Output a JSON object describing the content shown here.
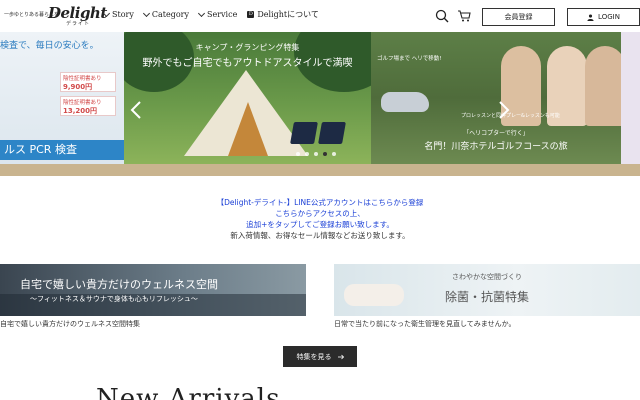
{
  "header": {
    "logo_tagline": "一歩ゆとりある暮らしを",
    "logo_name": "Delight",
    "logo_sub": "デライト",
    "nav": [
      {
        "label": "Story"
      },
      {
        "label": "Category"
      },
      {
        "label": "Service"
      },
      {
        "label": "Delightについて"
      }
    ],
    "register_label": "会員登録",
    "login_label": "LOGIN"
  },
  "hero": {
    "left_slide": {
      "top_text": "検査で、毎日の安心を。",
      "prices": [
        {
          "label": "陰性証明書あり",
          "value": "9,900円",
          "note": "(税込)"
        },
        {
          "label": "陰性証明書あり",
          "value": "13,200円",
          "note": "(税込)"
        }
      ],
      "bar_text": "ルス PCR 検査"
    },
    "main_slide": {
      "caption_small": "キャンプ・グランピング特集",
      "caption_large": "野外でもご自宅でもアウトドアスタイルで満喫"
    },
    "right_slide": {
      "cap_a": "ゴルフ場まで ヘリで移動!",
      "cap_b": "プロレッスンと同伴プレー&レッスンも可能",
      "cap_c": "「ヘリコプターで行く」",
      "cap_d": "名門！川奈ホテルゴルフコースの旅"
    },
    "dots_count": 5,
    "active_dot": 4
  },
  "notice": {
    "line1": "【Delight-デライト-】LINE公式アカウントはこちらから登録",
    "line2": "こちらからアクセスの上、",
    "line3": "追加+をタップしてご登録お願い致します。",
    "line4": "新入荷情報、お得なセール情報などお送り致します。"
  },
  "banners": {
    "left": {
      "title": "自宅で嬉しい貴方だけのウェルネス空間",
      "subtitle": "～フィットネス＆サウナで身体も心もリフレッシュ～",
      "caption": "自宅で嬉しい貴方だけのウェルネス空間特集"
    },
    "right": {
      "title_small": "さわやかな空間づくり",
      "title_large": "除菌・抗菌特集",
      "caption": "日常で当たり前になった衛生管理を見直してみませんか。"
    }
  },
  "feature_button": "特集を見る",
  "section_title": "New Arrivals",
  "colors": {
    "accent_gold": "#c9b48f",
    "link_blue": "#1a3fd6",
    "pcr_blue": "#2d85c7",
    "dark_button": "#2b2b2b"
  }
}
